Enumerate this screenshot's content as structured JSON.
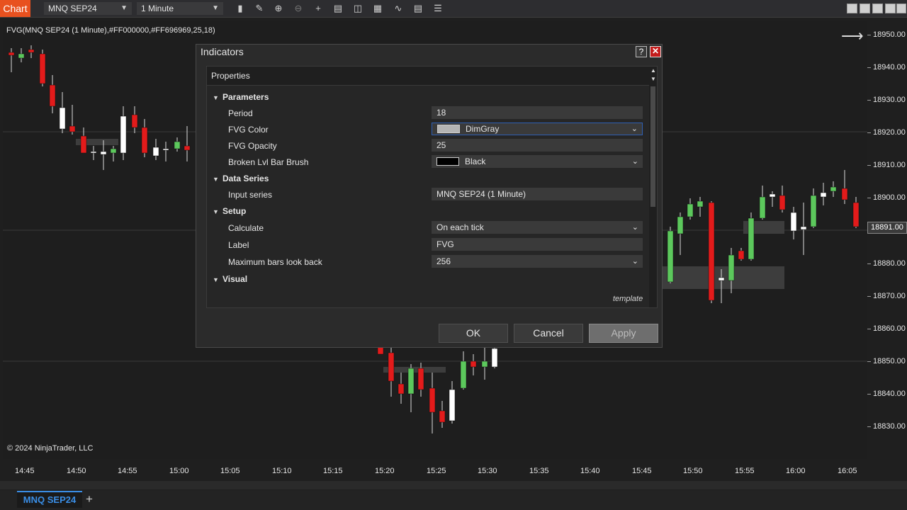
{
  "toolbar": {
    "brand": "Chart",
    "instrument": "MNQ SEP24",
    "interval": "1 Minute",
    "icons": [
      "bar-type-icon",
      "draw-tool-icon",
      "zoom-in-icon",
      "zoom-out-icon",
      "crosshair-icon",
      "properties-icon",
      "data-box-icon",
      "strategies-icon",
      "indicators-icon",
      "templates-icon",
      "more-icon"
    ]
  },
  "chart": {
    "indicator_label": "FVG(MNQ SEP24 (1 Minute),#FF000000,#FF696969,25,18)",
    "copyright": "© 2024 NinjaTrader, LLC",
    "price_axis": [
      "18950.00",
      "18940.00",
      "18930.00",
      "18920.00",
      "18910.00",
      "18900.00",
      "18880.00",
      "18870.00",
      "18860.00",
      "18850.00",
      "18840.00",
      "18830.00"
    ],
    "current_price": "18891.00",
    "time_axis": [
      "14:45",
      "14:50",
      "14:55",
      "15:00",
      "15:05",
      "15:10",
      "15:15",
      "15:20",
      "15:25",
      "15:30",
      "15:35",
      "15:40",
      "15:45",
      "15:50",
      "15:55",
      "16:00",
      "16:05"
    ],
    "colors": {
      "up": "#5cc85c",
      "down": "#e31b1b",
      "doji": "#ffffff",
      "fvg": "#696969"
    }
  },
  "dialog": {
    "title": "Indicators",
    "help": "?",
    "close": "✕",
    "panel_title": "Properties",
    "sections": {
      "parameters": "Parameters",
      "data_series": "Data Series",
      "setup": "Setup",
      "visual": "Visual"
    },
    "props": {
      "period": {
        "label": "Period",
        "value": "18"
      },
      "fvg_color": {
        "label": "FVG Color",
        "value": "DimGray",
        "swatch": "#b4b4b4"
      },
      "fvg_opacity": {
        "label": "FVG Opacity",
        "value": "25"
      },
      "broken_brush": {
        "label": "Broken Lvl Bar Brush",
        "value": "Black",
        "swatch": "#000000"
      },
      "input_series": {
        "label": "Input series",
        "value": "MNQ SEP24 (1 Minute)"
      },
      "calculate": {
        "label": "Calculate",
        "value": "On each tick"
      },
      "label": {
        "label": "Label",
        "value": "FVG"
      },
      "max_bars": {
        "label": "Maximum bars look back",
        "value": "256"
      }
    },
    "template_link": "template",
    "buttons": {
      "ok": "OK",
      "cancel": "Cancel",
      "apply": "Apply"
    }
  },
  "tabs": {
    "active": "MNQ SEP24",
    "add": "+"
  }
}
